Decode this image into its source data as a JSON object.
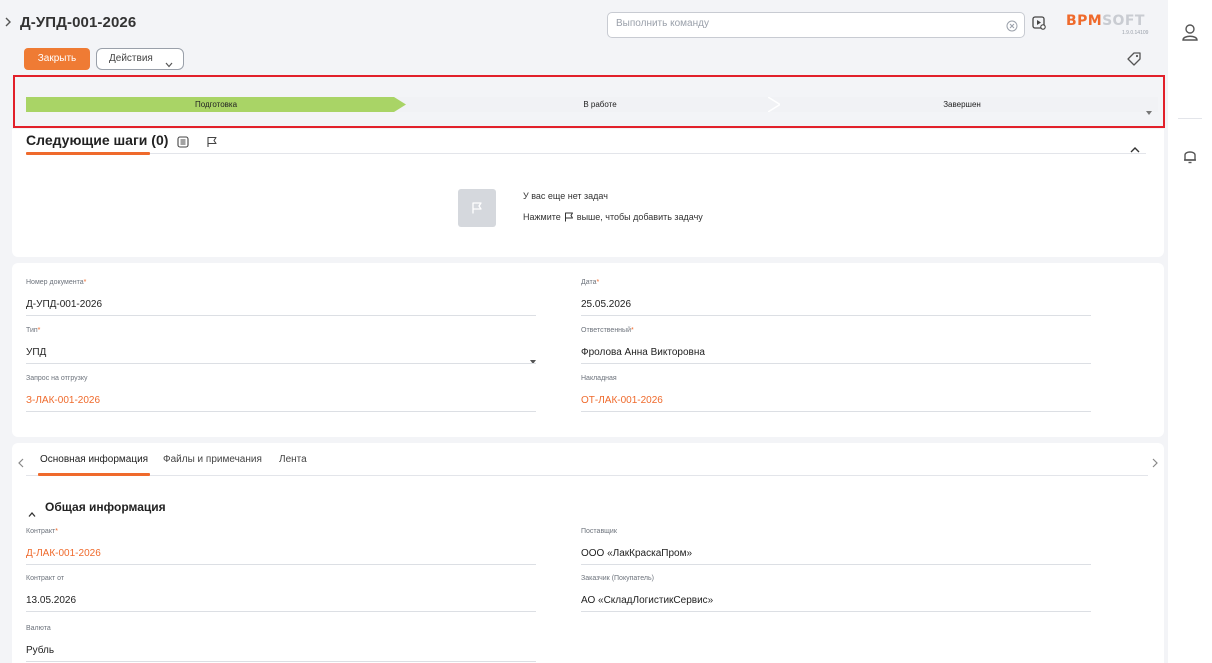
{
  "header": {
    "title": "Д-УПД-001-2026",
    "command_placeholder": "Выполнить команду",
    "logo_bpm": "BPM",
    "logo_soft": "SOFT",
    "version": "1.9.0.14109"
  },
  "toolbar": {
    "close_label": "Закрыть",
    "actions_label": "Действия"
  },
  "stages": {
    "items": [
      "Подготовка",
      "В работе",
      "Завершен"
    ],
    "active_index": 0,
    "active_color": "#a9d466"
  },
  "next_steps": {
    "title": "Следующие шаги (0)",
    "empty_title": "У вас еще нет задач",
    "hint_before": "Нажмите",
    "hint_after": "выше, чтобы добавить задачу"
  },
  "document": {
    "number_label": "Номер документа",
    "number_value": "Д-УПД-001-2026",
    "date_label": "Дата",
    "date_value": "25.05.2026",
    "type_label": "Тип",
    "type_value": "УПД",
    "responsible_label": "Ответственный",
    "responsible_value": "Фролова Анна Викторовна",
    "request_label": "Запрос на отгрузку",
    "request_value": "З-ЛАК-001-2026",
    "invoice_label": "Накладная",
    "invoice_value": "ОТ-ЛАК-001-2026"
  },
  "tabs": {
    "items": [
      "Основная информация",
      "Файлы и примечания",
      "Лента"
    ],
    "active_index": 0
  },
  "general": {
    "section_title": "Общая информация",
    "contract_label": "Контракт",
    "contract_value": "Д-ЛАК-001-2026",
    "supplier_label": "Поставщик",
    "supplier_value": "ООО «ЛакКраскаПром»",
    "contract_date_label": "Контракт от",
    "contract_date_value": "13.05.2026",
    "customer_label": "Заказчик (Покупатель)",
    "customer_value": "АО «СкладЛогистикСервис»",
    "currency_label": "Валюта",
    "currency_value": "Рубль"
  },
  "colors": {
    "accent": "#ef6a2c",
    "highlight": "#e2202a"
  }
}
